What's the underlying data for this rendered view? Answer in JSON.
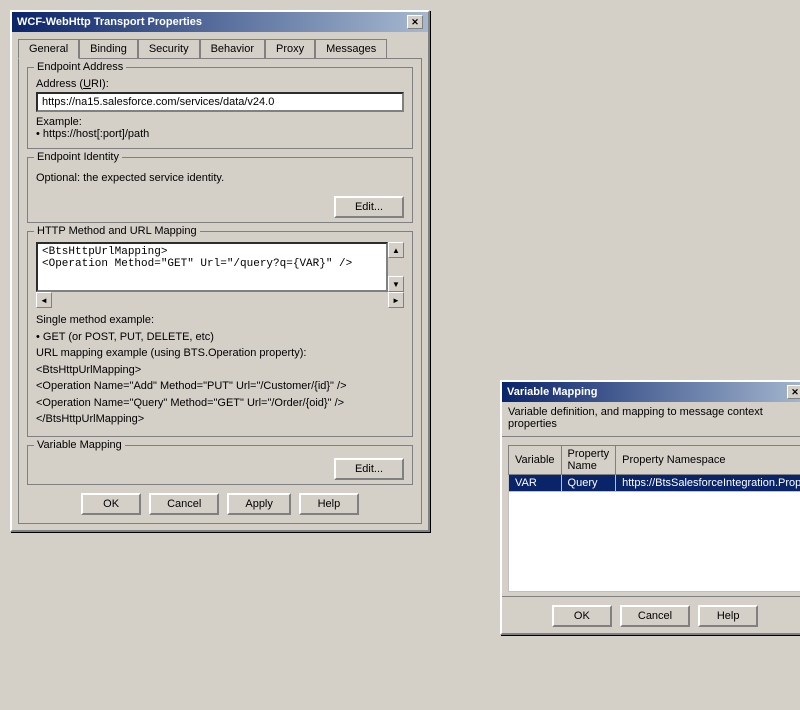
{
  "main_window": {
    "title": "WCF-WebHttp Transport Properties",
    "close_btn": "✕",
    "tabs": [
      {
        "label": "General",
        "underline": "",
        "active": true
      },
      {
        "label": "Binding",
        "underline": "B"
      },
      {
        "label": "Security",
        "underline": "S"
      },
      {
        "label": "Behavior",
        "underline": "e"
      },
      {
        "label": "Proxy",
        "underline": "P"
      },
      {
        "label": "Messages",
        "underline": "M"
      }
    ],
    "endpoint_address": {
      "group_title": "Endpoint Address",
      "address_label": "Address (URI):",
      "address_value": "https://na15.salesforce.com/services/data/v24.0",
      "example_title": "Example:",
      "example_text": "• https://host[:port]/path"
    },
    "endpoint_identity": {
      "group_title": "Endpoint Identity",
      "description": "Optional: the expected service identity.",
      "edit_btn": "Edit..."
    },
    "http_method": {
      "group_title": "HTTP Method and URL Mapping",
      "content_line1": "<BtsHttpUrlMapping>",
      "content_line2": "<Operation Method=\"GET\" Url=\"/query?q={VAR}\" />",
      "example_title": "Single method example:",
      "example_lines": [
        "• GET (or POST, PUT, DELETE, etc)",
        "URL mapping example (using BTS.Operation property):",
        "<BtsHttpUrlMapping>",
        "  <Operation Name=\"Add\" Method=\"PUT\" Url=\"/Customer/{id}\" />",
        "  <Operation Name=\"Query\" Method=\"GET\" Url=\"/Order/{oid}\" />",
        "</BtsHttpUrlMapping>"
      ]
    },
    "variable_mapping": {
      "group_title": "Variable Mapping",
      "edit_btn": "Edit..."
    },
    "buttons": {
      "ok": "OK",
      "cancel": "Cancel",
      "apply": "Apply",
      "help": "Help"
    }
  },
  "var_mapping_dialog": {
    "title": "Variable Mapping",
    "close_btn": "✕",
    "subtitle": "Variable definition, and mapping to message context properties",
    "table": {
      "headers": [
        "Variable",
        "Property Name",
        "Property Namespace"
      ],
      "rows": [
        {
          "variable": "VAR",
          "property_name": "Query",
          "property_namespace": "https://BtsSalesforceIntegration.Prope"
        }
      ]
    },
    "buttons": {
      "ok": "OK",
      "cancel": "Cancel",
      "help": "Help"
    }
  }
}
